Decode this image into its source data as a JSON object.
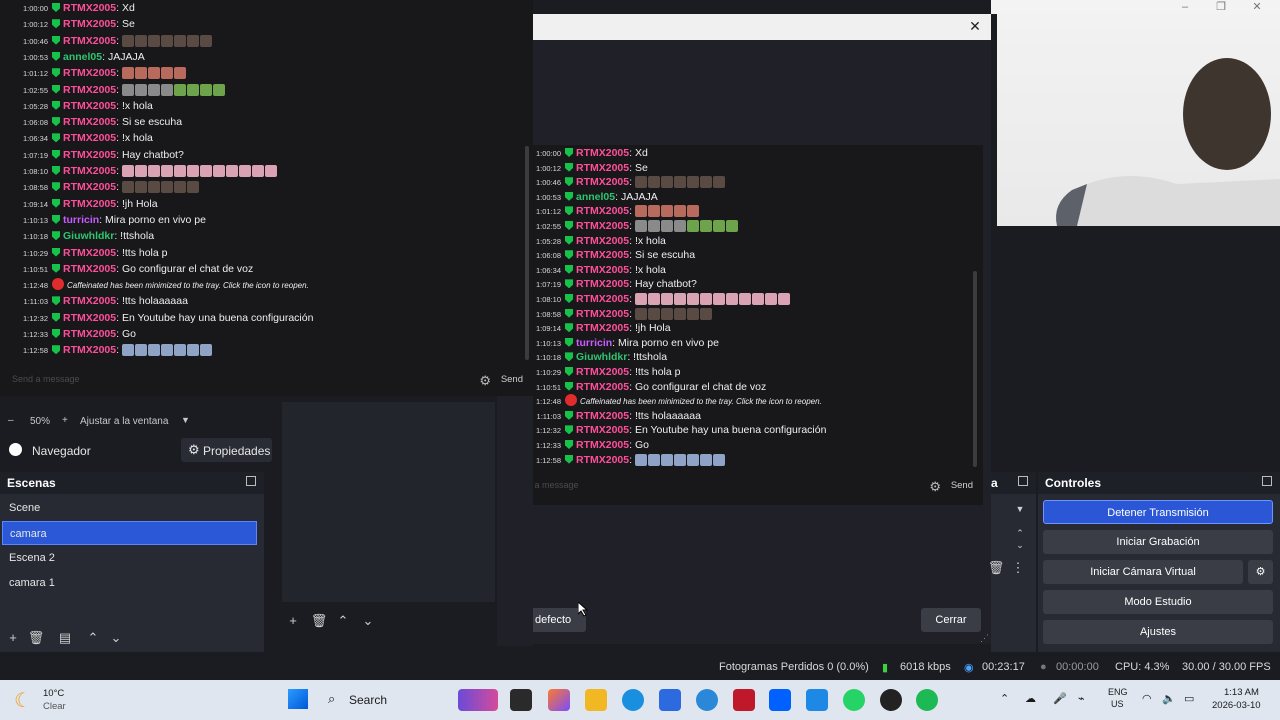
{
  "chat": {
    "lines": [
      {
        "ts": "1:00:00",
        "user": "RTMX2005",
        "msg": ": Xd"
      },
      {
        "ts": "1:00:12",
        "user": "RTMX2005",
        "msg": ": Se"
      },
      {
        "ts": "1:00:46",
        "user": "RTMX2005",
        "msg": ":"
      },
      {
        "ts": "1:00:53",
        "user": "annel05",
        "msg": ": JAJAJA"
      },
      {
        "ts": "1:01:12",
        "user": "RTMX2005",
        "msg": ":"
      },
      {
        "ts": "1:02:55",
        "user": "RTMX2005",
        "msg": ":"
      },
      {
        "ts": "1:05:28",
        "user": "RTMX2005",
        "msg": ": !x hola"
      },
      {
        "ts": "1:06:08",
        "user": "RTMX2005",
        "msg": ": Si se escuha"
      },
      {
        "ts": "1:06:34",
        "user": "RTMX2005",
        "msg": ": !x hola"
      },
      {
        "ts": "1:07:19",
        "user": "RTMX2005",
        "msg": ": Hay chatbot?"
      },
      {
        "ts": "1:08:10",
        "user": "RTMX2005",
        "msg": ":"
      },
      {
        "ts": "1:08:58",
        "user": "RTMX2005",
        "msg": ":"
      },
      {
        "ts": "1:09:14",
        "user": "RTMX2005",
        "msg": ": !jh Hola"
      },
      {
        "ts": "1:10:13",
        "user": "turricin",
        "msg": ": Mira porno en vivo pe"
      },
      {
        "ts": "1:10:18",
        "user": "Giuwhldkr",
        "msg": ": !ttshola"
      },
      {
        "ts": "1:10:29",
        "user": "RTMX2005",
        "msg": ": !tts hola p"
      },
      {
        "ts": "1:10:51",
        "user": "RTMX2005",
        "msg": ": Go configurar el chat de voz"
      },
      {
        "ts": "1:12:48",
        "user": "",
        "msg": "Caffeinated has been minimized to the tray. Click the icon to reopen."
      },
      {
        "ts": "1:11:03",
        "user": "RTMX2005",
        "msg": ": !tts holaaaaaa"
      },
      {
        "ts": "1:12:32",
        "user": "RTMX2005",
        "msg": ": En Youtube hay una buena configuración"
      },
      {
        "ts": "1:12:33",
        "user": "RTMX2005",
        "msg": ": Go"
      },
      {
        "ts": "1:12:58",
        "user": "RTMX2005",
        "msg": ":"
      }
    ],
    "input_placeholder": "Send a message",
    "send_label": "Send"
  },
  "dialog": {
    "default_button": "Por defecto",
    "close_button": "Cerrar",
    "close_icon": "close-icon"
  },
  "zoom": {
    "level": "50%",
    "fit_label": "Ajustar a la ventana"
  },
  "nav": {
    "navigator_label": "Navegador",
    "properties_label": "Propiedades"
  },
  "scenes": {
    "title": "Escenas",
    "items": [
      "Scene",
      "camara",
      "Escena 2",
      "camara 1"
    ],
    "active_index": 1
  },
  "mixer": {
    "title_fragment": "a"
  },
  "controls": {
    "title": "Controles",
    "buttons": [
      "Detener Transmisión",
      "Iniciar Grabación",
      "Iniciar Cámara Virtual",
      "Modo Estudio",
      "Ajustes"
    ]
  },
  "status": {
    "dropped": "Fotogramas Perdidos 0 (0.0%)",
    "bitrate": "6018 kbps",
    "live_time": "00:23:17",
    "rec_time": "00:00:00",
    "cpu": "CPU: 4.3%",
    "fps": "30.00 / 30.00 FPS"
  },
  "taskbar": {
    "weather_temp": "10°C",
    "weather_desc": "Clear",
    "search_label": "Search",
    "lang1": "ENG",
    "lang2": "US",
    "time": "1:13 AM",
    "date": "2026-03-10"
  },
  "colors": {
    "accent": "#2b57d6",
    "username": "#ff4f9a",
    "chat_bg": "#18181b"
  }
}
